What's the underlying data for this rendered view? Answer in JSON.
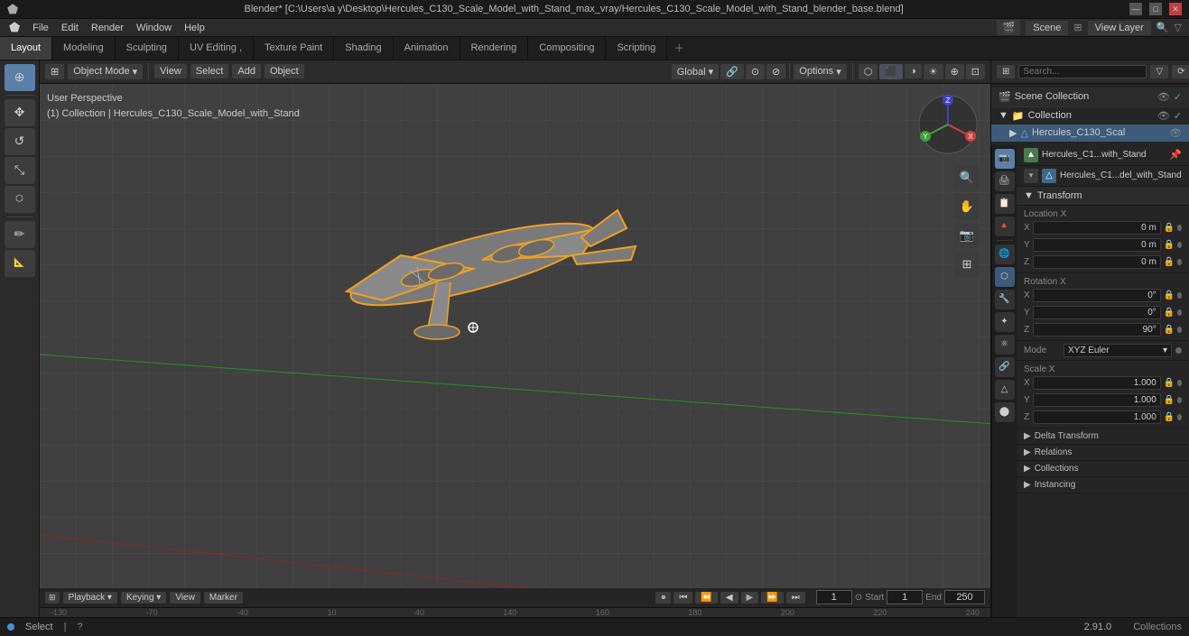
{
  "window": {
    "title": "Blender* [C:\\Users\\a y\\Desktop\\Hercules_C130_Scale_Model_with_Stand_max_vray/Hercules_C130_Scale_Model_with_Stand_blender_base.blend]",
    "version": "2.91.0"
  },
  "menu": {
    "items": [
      "Blender",
      "File",
      "Edit",
      "Render",
      "Window",
      "Help"
    ]
  },
  "workspace_tabs": [
    {
      "label": "Layout",
      "active": true
    },
    {
      "label": "Modeling",
      "active": false
    },
    {
      "label": "Sculpting",
      "active": false
    },
    {
      "label": "UV Editing",
      "active": false
    },
    {
      "label": "Texture Paint",
      "active": false
    },
    {
      "label": "Shading",
      "active": false
    },
    {
      "label": "Animation",
      "active": false
    },
    {
      "label": "Rendering",
      "active": false
    },
    {
      "label": "Compositing",
      "active": false
    },
    {
      "label": "Scripting",
      "active": false
    }
  ],
  "viewport": {
    "mode": "Object Mode",
    "view": "View",
    "select": "Select",
    "add": "Add",
    "object": "Object",
    "perspective": "User Perspective",
    "collection": "(1) Collection | Hercules_C130_Scale_Model_with_Stand",
    "shading": {
      "options_label": "Options"
    }
  },
  "scene": {
    "name": "Scene",
    "view_layer": "View Layer"
  },
  "outliner": {
    "scene_collection": "Scene Collection",
    "items": [
      {
        "name": "Collection",
        "type": "collection",
        "visible": true,
        "selected": false,
        "children": [
          {
            "name": "Hercules_C130_Scal",
            "type": "mesh",
            "visible": true,
            "selected": true
          }
        ]
      }
    ]
  },
  "properties": {
    "object_name": "Hercules_C1...with_Stand",
    "object_name_full": "Hercules_C1...del_with_Stand",
    "transform_label": "Transform",
    "location": {
      "x": "0 m",
      "y": "0 m",
      "z": "0 m"
    },
    "rotation": {
      "x": "0°",
      "y": "0°",
      "z": "90°"
    },
    "rotation_mode": {
      "label": "Mode",
      "value": "XYZ Euler"
    },
    "scale": {
      "x": "1.000",
      "y": "1.000",
      "z": "1.000"
    },
    "delta_transform": "Delta Transform",
    "relations": "Relations",
    "collections": "Collections",
    "instancing": "Instancing"
  },
  "timeline": {
    "playback_label": "Playback",
    "keying_label": "Keying",
    "view_label": "View",
    "marker_label": "Marker",
    "current_frame": "1",
    "start_label": "Start",
    "start_frame": "1",
    "end_label": "End",
    "end_frame": "250",
    "frame_numbers": [
      "-130",
      "-70",
      "-40",
      "10",
      "40",
      "140",
      "160",
      "180",
      "200",
      "220",
      "240"
    ]
  },
  "status_bar": {
    "left": "Select",
    "version": "2.91.0",
    "collections_label": "Collections"
  },
  "icons": {
    "cursor": "⊕",
    "move": "✥",
    "rotate": "↻",
    "scale": "⇔",
    "transform": "⬡",
    "annotate": "✏",
    "measure": "📐",
    "zoom": "🔍",
    "hand": "✋",
    "camera": "📷",
    "grid": "⊞",
    "triangle_right": "▶",
    "triangle_down": "▼",
    "eye": "👁",
    "check": "✓",
    "pin": "📌",
    "lock": "🔒",
    "dot": "●"
  }
}
